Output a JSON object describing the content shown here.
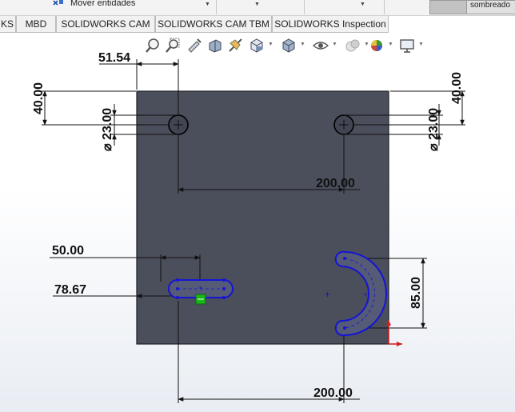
{
  "topbar": {
    "move_entities_label": "Mover entidades",
    "shading_label": "sombreado"
  },
  "tabs": [
    {
      "label": "KS"
    },
    {
      "label": "MBD"
    },
    {
      "label": "SOLIDWORKS CAM"
    },
    {
      "label": "SOLIDWORKS CAM TBM"
    },
    {
      "label": "SOLIDWORKS Inspection"
    }
  ],
  "toolbar": {
    "icons": [
      "zoom-to-fit-icon",
      "zoom-to-area-icon",
      "previous-view-icon",
      "section-view-icon",
      "dynamic-annotation-icon",
      "view-orientation-icon",
      "display-style-icon",
      "hide-show-icon",
      "edit-appearance-icon",
      "apply-scene-icon",
      "view-settings-icon"
    ]
  },
  "drawing": {
    "colors": {
      "plate": "#4b4e5b",
      "sketch": "#1414d8",
      "dimension": "#111111",
      "point": "#19b819"
    },
    "dimensions": {
      "hole_x_offset": "51.54",
      "left_top_offset": "40.00",
      "left_hole_diameter": "⌀ 23.00",
      "right_top_offset": "40.00",
      "right_hole_diameter": "⌀ 23.00",
      "hole_spacing": "200.00",
      "slot_length": "50.00",
      "slot_x_offset": "78.67",
      "arc_slot_height": "85.00",
      "bottom_spacing": "200.00"
    }
  }
}
